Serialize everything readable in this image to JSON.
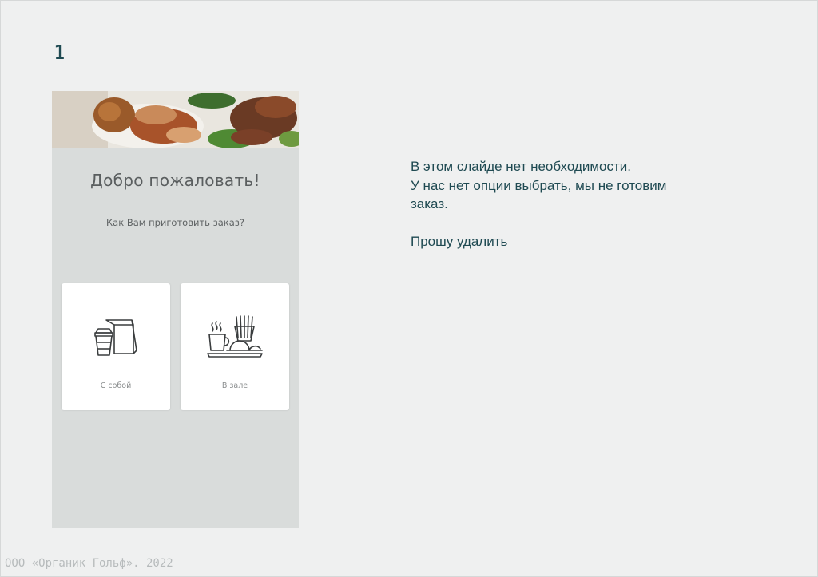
{
  "slide": {
    "number": "1"
  },
  "app_screen": {
    "title": "Добро пожаловать!",
    "subtitle": "Как Вам приготовить заказ?",
    "options": [
      {
        "label": "С собой",
        "icon": "takeaway-bag-cup-icon"
      },
      {
        "label": "В зале",
        "icon": "dine-in-tray-icon"
      }
    ]
  },
  "note": {
    "lines": [
      "В этом слайде нет необходимости.",
      "У нас нет опции выбрать, мы не готовим",
      "заказ.",
      "Прошу удалить"
    ]
  },
  "footer": {
    "text": "ООО «Органик Гольф». 2022"
  },
  "colors": {
    "slide_bg": "#eff0f0",
    "accent_text": "#1f4a52",
    "phone_bg": "#d9dcdb",
    "card_bg": "#ffffff"
  }
}
